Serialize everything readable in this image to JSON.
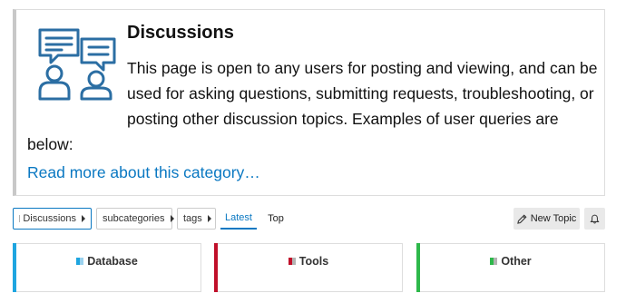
{
  "about": {
    "title": "Discussions",
    "text": "This page is open to any users for posting and viewing, and can be used for asking questions, submitting requests, troubleshooting, or posting other discussion topics. Examples of user queries are below:",
    "read_more": "Read more about this category…",
    "icon": "discussion-people-icon",
    "icon_color": "#2b6ea3"
  },
  "nav": {
    "category_dropdown": "Discussions",
    "subcategories_dropdown": "subcategories",
    "tags_dropdown": "tags",
    "tabs": [
      {
        "label": "Latest",
        "active": true
      },
      {
        "label": "Top",
        "active": false
      }
    ],
    "new_topic": "New Topic",
    "notifications_icon": "bell-icon"
  },
  "categories": [
    {
      "name": "Database",
      "color": "#1ea5e0"
    },
    {
      "name": "Tools",
      "color": "#c0102a"
    },
    {
      "name": "Other",
      "color": "#2eb84b"
    }
  ],
  "colors": {
    "accent": "#0a78c2",
    "border": "#dddddd"
  }
}
